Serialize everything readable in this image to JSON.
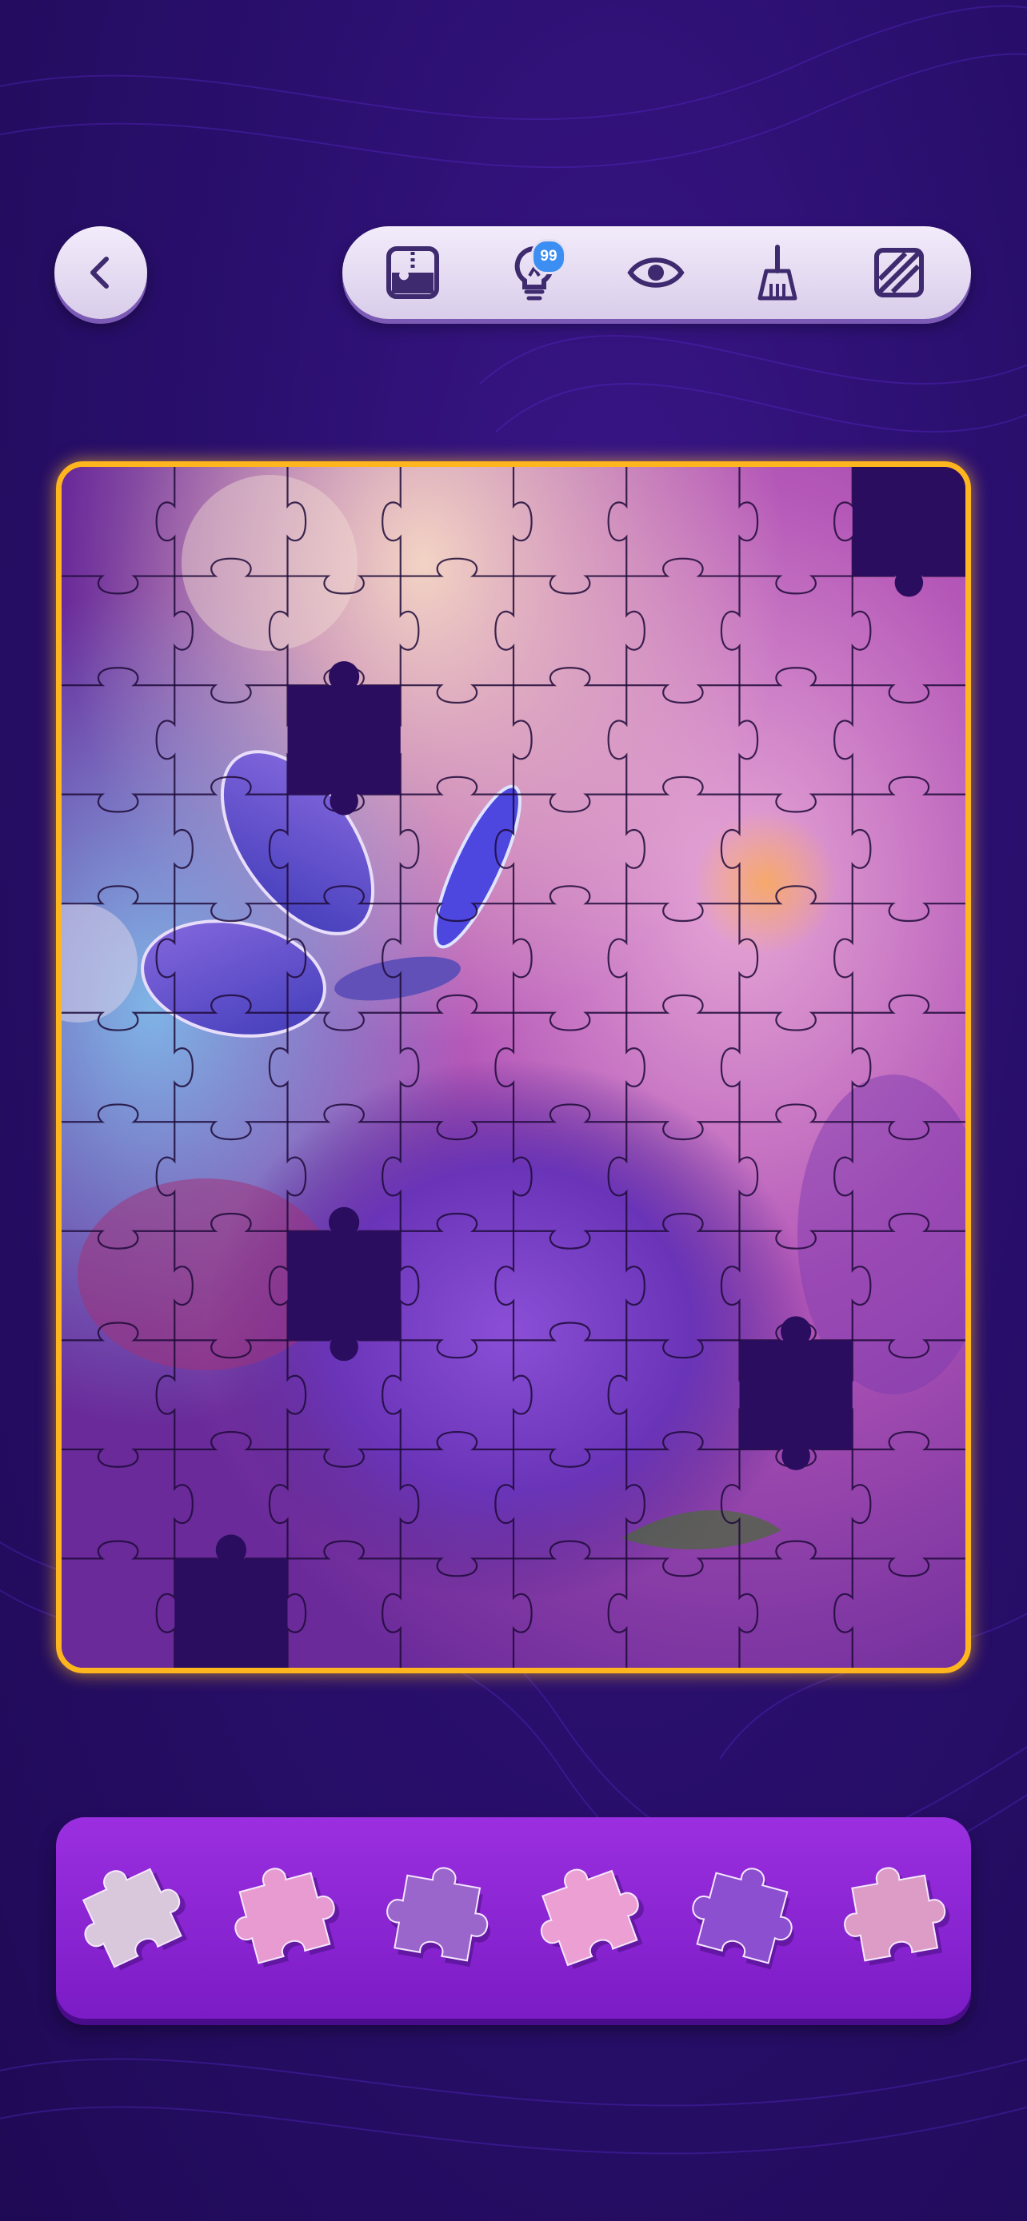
{
  "toolbar": {
    "back_icon": "chevron-left-icon",
    "tools": [
      {
        "name": "edge-pieces-icon"
      },
      {
        "name": "hint-bulb-icon",
        "badge": "99"
      },
      {
        "name": "preview-eye-icon"
      },
      {
        "name": "broom-icon"
      },
      {
        "name": "background-pattern-icon"
      }
    ]
  },
  "board": {
    "columns": 8,
    "rows": 11,
    "missing_slots": [
      {
        "col": 7,
        "row": 0
      },
      {
        "col": 2,
        "row": 2
      },
      {
        "col": 2,
        "row": 7
      },
      {
        "col": 6,
        "row": 8
      },
      {
        "col": 1,
        "row": 10
      }
    ],
    "frame_color": "#ffb51e",
    "hole_color": "#2a0d5e"
  },
  "tray": {
    "pieces": [
      {
        "name": "tray-piece-1",
        "tone": "#d9c8dc"
      },
      {
        "name": "tray-piece-2",
        "tone": "#e79bd0"
      },
      {
        "name": "tray-piece-3",
        "tone": "#9a66cc"
      },
      {
        "name": "tray-piece-4",
        "tone": "#ec9fd2"
      },
      {
        "name": "tray-piece-5",
        "tone": "#8c4fd0"
      },
      {
        "name": "tray-piece-6",
        "tone": "#dd9cc6"
      }
    ]
  },
  "colors": {
    "background": "#2a0f6e",
    "tray": "#8f27d8",
    "accent": "#ffb51e",
    "badge": "#3d8ef2"
  }
}
